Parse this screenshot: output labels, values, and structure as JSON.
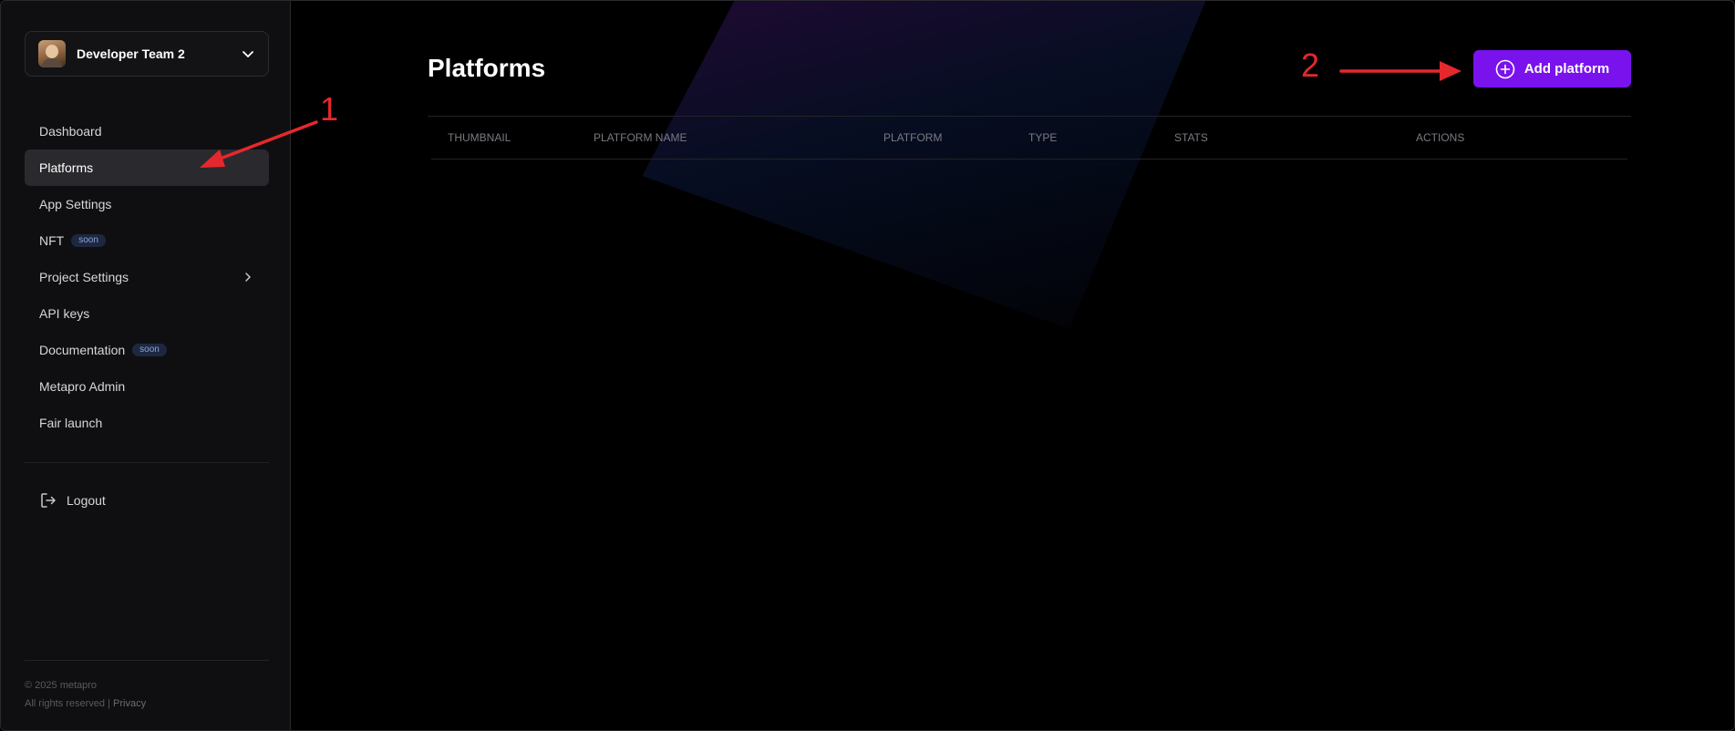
{
  "sidebar": {
    "team": {
      "name": "Developer Team 2"
    },
    "nav": [
      {
        "label": "Dashboard"
      },
      {
        "label": "Platforms",
        "active": true
      },
      {
        "label": "App Settings"
      },
      {
        "label": "NFT",
        "badge": "soon"
      },
      {
        "label": "Project Settings",
        "has_submenu": true
      },
      {
        "label": "API keys"
      },
      {
        "label": "Documentation",
        "badge": "soon"
      },
      {
        "label": "Metapro Admin"
      },
      {
        "label": "Fair launch"
      }
    ],
    "logout_label": "Logout",
    "footer": {
      "copyright": "© 2025 metapro",
      "rights": "All rights reserved |",
      "privacy": "Privacy"
    }
  },
  "main": {
    "title": "Platforms",
    "add_button_label": "Add platform",
    "table": {
      "columns": [
        "THUMBNAIL",
        "PLATFORM NAME",
        "PLATFORM",
        "TYPE",
        "STATS",
        "ACTIONS"
      ]
    }
  },
  "annotations": {
    "step1": "1",
    "step2": "2"
  },
  "colors": {
    "accent": "#7a12ee",
    "annotation": "#e5282c",
    "badge_bg": "#1d2840"
  }
}
